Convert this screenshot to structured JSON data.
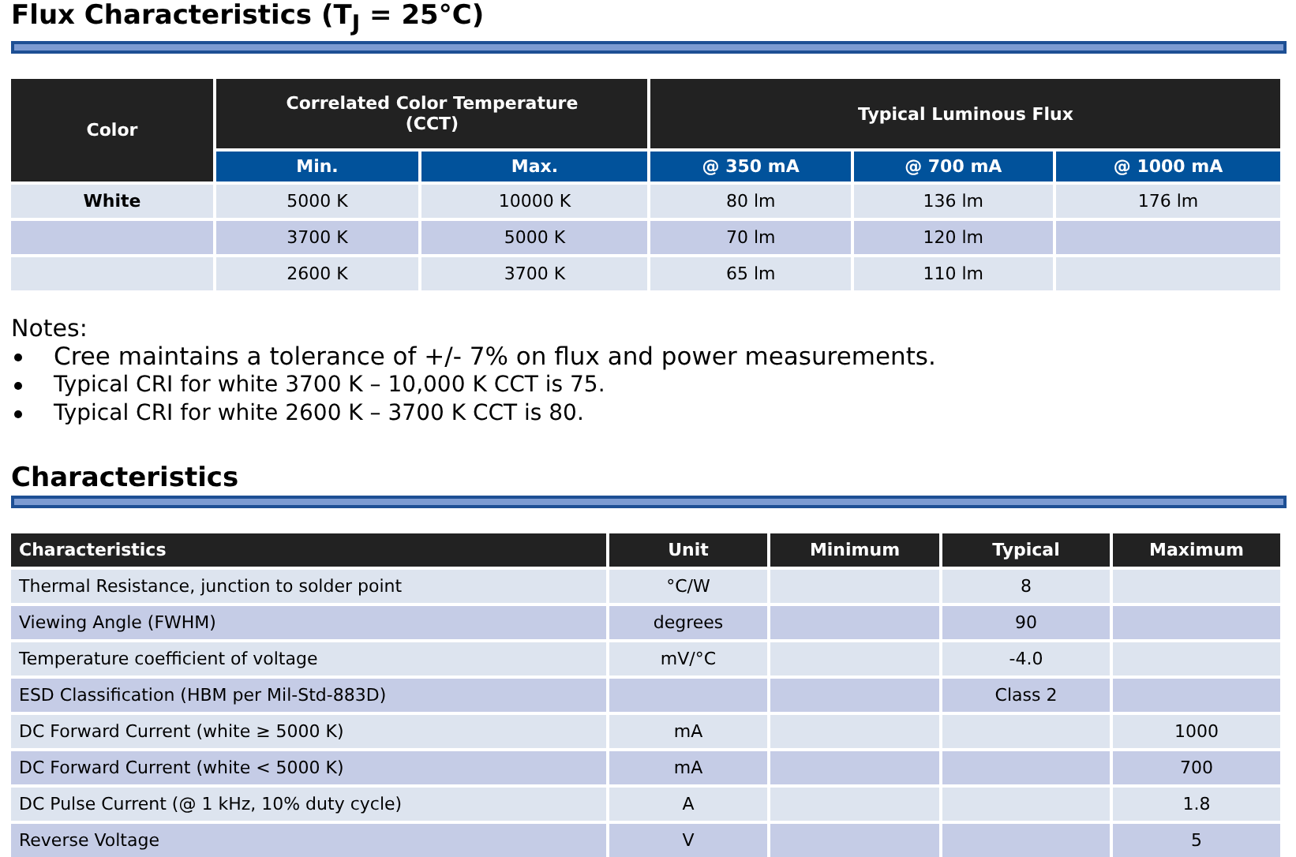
{
  "flux": {
    "title": "Flux Characteristics (T$_{J}$ = 25°C)",
    "table": {
      "first_header": "Color",
      "groups": [
        {
          "label": "Correlated Color Temperature (CCT)",
          "columns": [
            "Min.",
            "Max."
          ]
        },
        {
          "label": "Typical Luminous Flux",
          "columns": [
            "@ 350 mA",
            "@ 700 mA",
            "@ 1000 mA"
          ]
        }
      ],
      "rows": [
        [
          "White",
          "5000 K",
          "10000 K",
          "80 lm",
          "136 lm",
          "176 lm"
        ],
        [
          null,
          "3700 K",
          "5000 K",
          "70 lm",
          "120 lm",
          null
        ],
        [
          null,
          "2600 K",
          "3700 K",
          "65 lm",
          "110 lm",
          null
        ]
      ]
    }
  },
  "notes": {
    "title": "Notes:",
    "items": [
      "Cree maintains a tolerance of +/- 7% on flux and power measurements.",
      "Typical CRI for white 3700 K – 10,000 K CCT is 75.",
      "Typical CRI for white 2600 K – 3700 K CCT is 80."
    ]
  },
  "characteristics": {
    "title": "Characteristics",
    "table": {
      "columns": [
        "Characteristics",
        "Unit",
        "Minimum",
        "Typical",
        "Maximum"
      ],
      "rows": [
        [
          "Thermal Resistance, junction to solder point",
          "°C/W",
          null,
          "8",
          null
        ],
        [
          "Viewing Angle (FWHM)",
          "degrees",
          null,
          "90",
          null
        ],
        [
          "Temperature coefficient of voltage",
          "mV/°C",
          null,
          "-4.0",
          null
        ],
        [
          "ESD Classification (HBM per Mil-Std-883D)",
          null,
          null,
          "Class 2",
          null
        ],
        [
          "DC Forward Current (white ≥ 5000 K)",
          "mA",
          null,
          null,
          "1000"
        ],
        [
          "DC Forward Current (white < 5000 K)",
          "mA",
          null,
          null,
          "700"
        ],
        [
          "DC Pulse Current (@ 1 kHz, 10% duty cycle)",
          "A",
          null,
          null,
          "1.8"
        ],
        [
          "Reverse Voltage",
          "V",
          null,
          null,
          "5"
        ]
      ]
    }
  }
}
